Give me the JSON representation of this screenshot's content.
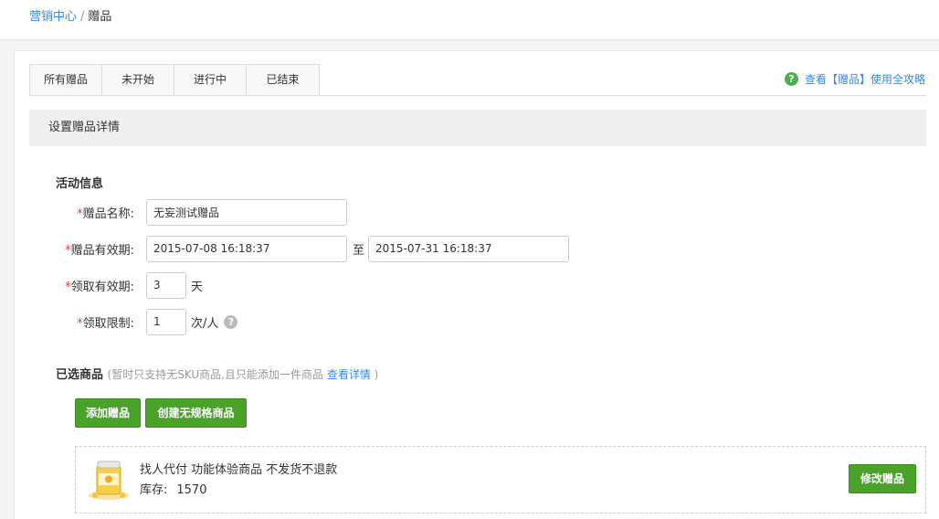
{
  "breadcrumb": {
    "parent": "营销中心",
    "separator": "/",
    "current": "赠品"
  },
  "tabs": [
    {
      "label": "所有赠品"
    },
    {
      "label": "未开始"
    },
    {
      "label": "进行中"
    },
    {
      "label": "已结束"
    }
  ],
  "help": {
    "icon": "help-question-icon",
    "text": "查看【赠品】使用全攻略"
  },
  "section_title": "设置赠品详情",
  "activity": {
    "title": "活动信息",
    "required_mark": "*",
    "name": {
      "label": "赠品名称:",
      "value": "无妄测试赠品"
    },
    "validity": {
      "label": "赠品有效期:",
      "start": "2015-07-08 16:18:37",
      "to": "至",
      "end": "2015-07-31 16:18:37"
    },
    "claim_validity": {
      "label": "领取有效期:",
      "value": "3",
      "unit": "天"
    },
    "claim_limit": {
      "label": "领取限制:",
      "value": "1",
      "unit": "次/人"
    }
  },
  "selected_goods": {
    "title": "已选商品",
    "note_prefix": "(暂时只支持无SKU商品,且只能添加一件商品",
    "note_link": "查看详情",
    "note_suffix": ")",
    "add_button": "添加赠品",
    "create_button": "创建无规格商品"
  },
  "goods_item": {
    "name": "找人代付 功能体验商品 不发货不退款",
    "stock_label": "库存:",
    "stock_value": "1570",
    "edit_button": "修改赠品"
  },
  "colors": {
    "accent_blue": "#3388ff",
    "button_green": "#4ba22a",
    "help_green": "#4bb04b",
    "required_red": "#e4393c"
  }
}
